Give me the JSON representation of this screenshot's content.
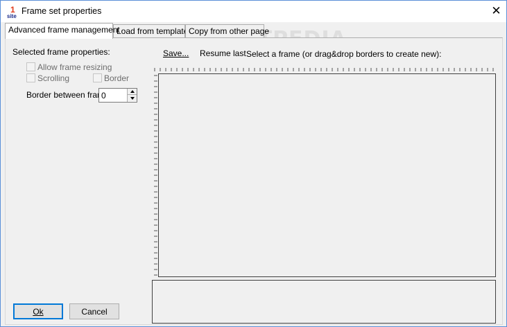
{
  "window": {
    "title": "Frame set properties",
    "close_glyph": "✕",
    "icon": "app-logo-icon"
  },
  "tabs": [
    {
      "label": "Advanced frame management",
      "active": true
    },
    {
      "label": "Load from template",
      "active": false
    },
    {
      "label": "Copy from other page",
      "active": false
    }
  ],
  "left_panel": {
    "section_label": "Selected frame properties:",
    "allow_resizing_label": "Allow frame resizing",
    "scrolling_label": "Scrolling",
    "border_label": "Border",
    "border_between_label": "Border between frame",
    "border_between_value": "0"
  },
  "toolbar": {
    "save_label": "Save...",
    "resume_label": "Resume last",
    "instruction": "Select a frame (or drag&drop borders to create new):"
  },
  "buttons": {
    "ok_label": "Ok",
    "cancel_label": "Cancel"
  },
  "watermark": "SOFTPEDIA",
  "colors": {
    "accent": "#0078d7",
    "window_border": "#5a8fd8",
    "logo_red": "#e03c1c",
    "logo_text": "#1a2a8a"
  }
}
